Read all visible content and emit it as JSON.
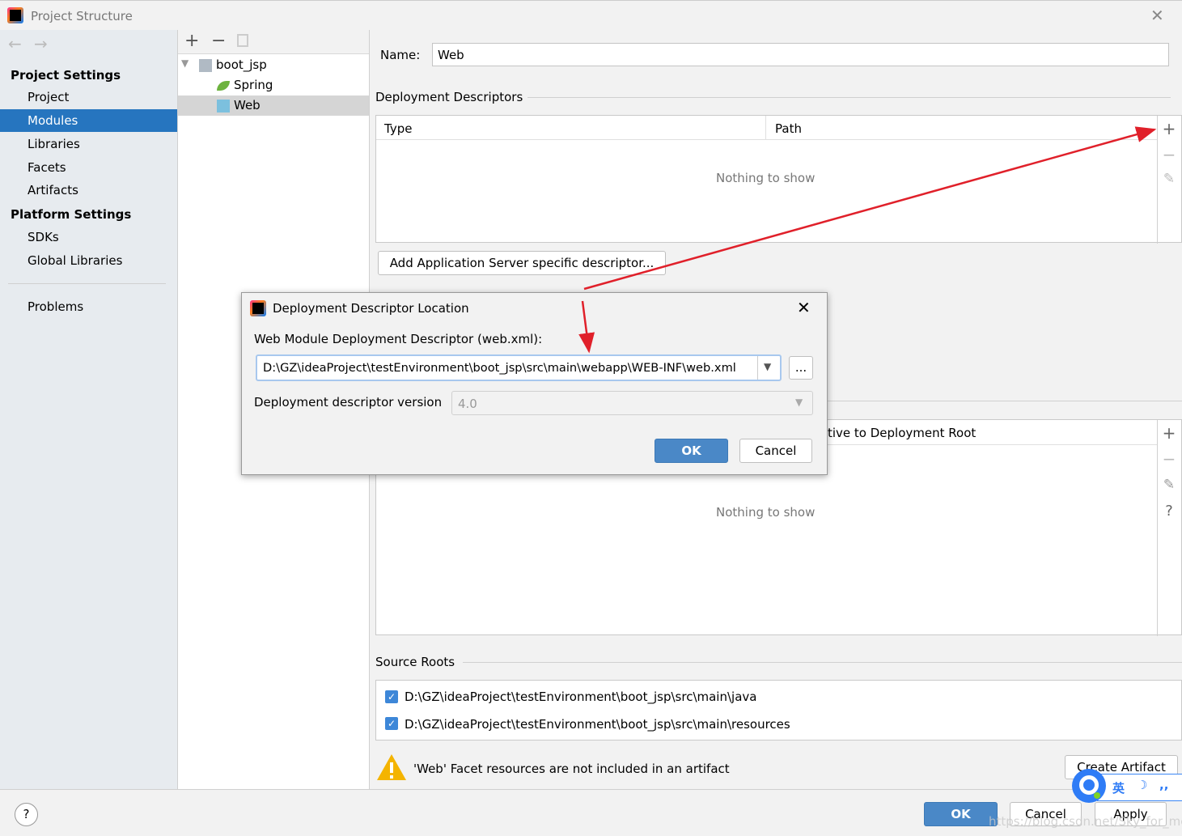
{
  "window": {
    "title": "Project Structure",
    "close_icon": "close-icon"
  },
  "sidebar": {
    "project_settings": "Project Settings",
    "items_top": [
      {
        "label": "Project"
      },
      {
        "label": "Modules",
        "selected": true
      },
      {
        "label": "Libraries"
      },
      {
        "label": "Facets"
      },
      {
        "label": "Artifacts"
      }
    ],
    "platform_settings": "Platform Settings",
    "items_platform": [
      {
        "label": "SDKs"
      },
      {
        "label": "Global Libraries"
      }
    ],
    "problems": "Problems"
  },
  "tree": {
    "root": "boot_jsp",
    "children": [
      "Spring",
      "Web"
    ],
    "selected": "Web"
  },
  "main": {
    "name_label": "Name:",
    "name_value": "Web",
    "deployment_descriptors": "Deployment Descriptors",
    "col_type": "Type",
    "col_path": "Path",
    "empty": "Nothing to show",
    "add_server_descriptor": "Add Application Server specific descriptor...",
    "web_roots_col_partial": "tive to Deployment Root",
    "empty2": "Nothing to show",
    "source_roots": "Source Roots",
    "source_paths": [
      {
        "path": "D:\\GZ\\ideaProject\\testEnvironment\\boot_jsp\\src\\main\\java",
        "checked": true
      },
      {
        "path": "D:\\GZ\\ideaProject\\testEnvironment\\boot_jsp\\src\\main\\resources",
        "checked": true
      }
    ],
    "warning": "'Web' Facet resources are not included in an artifact",
    "create_artifact": "Create Artifact"
  },
  "dialog": {
    "title": "Deployment Descriptor Location",
    "field_label": "Web Module Deployment Descriptor (web.xml):",
    "path_value": "D:\\GZ\\ideaProject\\testEnvironment\\boot_jsp\\src\\main\\webapp\\WEB-INF\\web.xml",
    "browse": "...",
    "version_label": "Deployment descriptor version",
    "version_value": "4.0",
    "ok": "OK",
    "cancel": "Cancel"
  },
  "footer": {
    "help": "?",
    "ok": "OK",
    "cancel": "Cancel",
    "apply": "Apply",
    "watermark": "https://blog.csdn.net/Sky_for_me"
  },
  "ime": {
    "label": "英"
  },
  "colors": {
    "accent": "#2675bf",
    "ok_button": "#4a88c7",
    "annotation_arrow": "#e0202a",
    "warning": "#f4b400"
  }
}
